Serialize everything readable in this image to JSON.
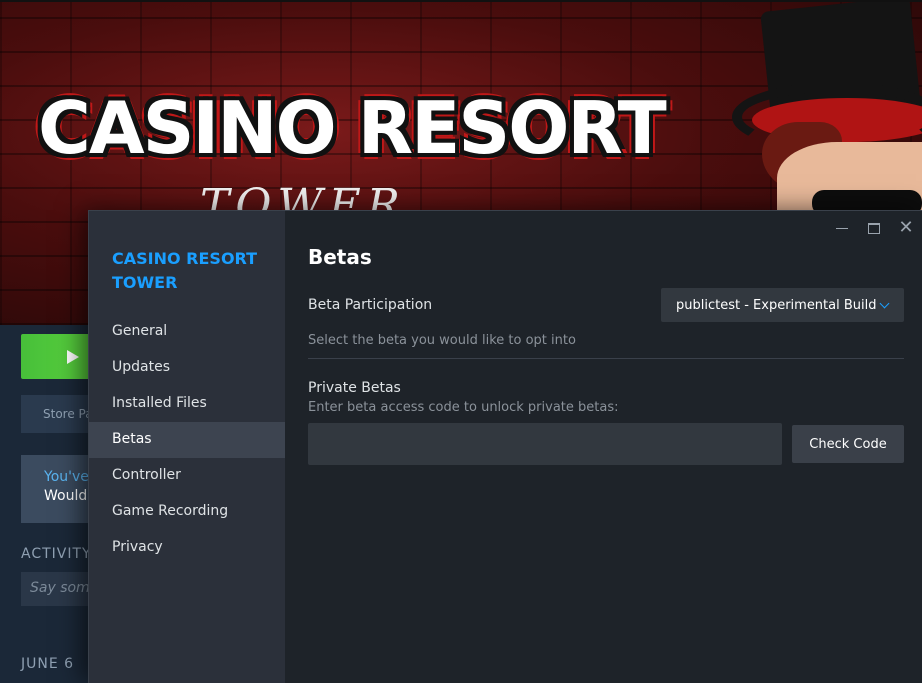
{
  "background": {
    "hero_title": "CASINO RESORT",
    "hero_subtitle": "TOWER",
    "store_button": "Store Page",
    "notice_line1": "You've",
    "notice_line2": "Would",
    "activity_label": "ACTIVITY",
    "say_placeholder": "Say something",
    "date_label": "JUNE 6"
  },
  "dialog": {
    "game_name": "CASINO RESORT TOWER",
    "nav": [
      {
        "label": "General"
      },
      {
        "label": "Updates"
      },
      {
        "label": "Installed Files"
      },
      {
        "label": "Betas",
        "active": true
      },
      {
        "label": "Controller"
      },
      {
        "label": "Game Recording"
      },
      {
        "label": "Privacy"
      }
    ],
    "page_title": "Betas",
    "beta_participation": {
      "label": "Beta Participation",
      "selected": "publictest - Experimental Build",
      "hint": "Select the beta you would like to opt into"
    },
    "private_betas": {
      "title": "Private Betas",
      "hint": "Enter beta access code to unlock private betas:",
      "input_value": "",
      "button": "Check Code"
    },
    "window_controls": {
      "close": "✕"
    }
  },
  "colors": {
    "accent": "#1a9fff",
    "dialog_bg": "#1e2329",
    "sidebar_bg": "#2b303a",
    "active_item_bg": "#3d4450",
    "play_green": "#5ad13d"
  }
}
